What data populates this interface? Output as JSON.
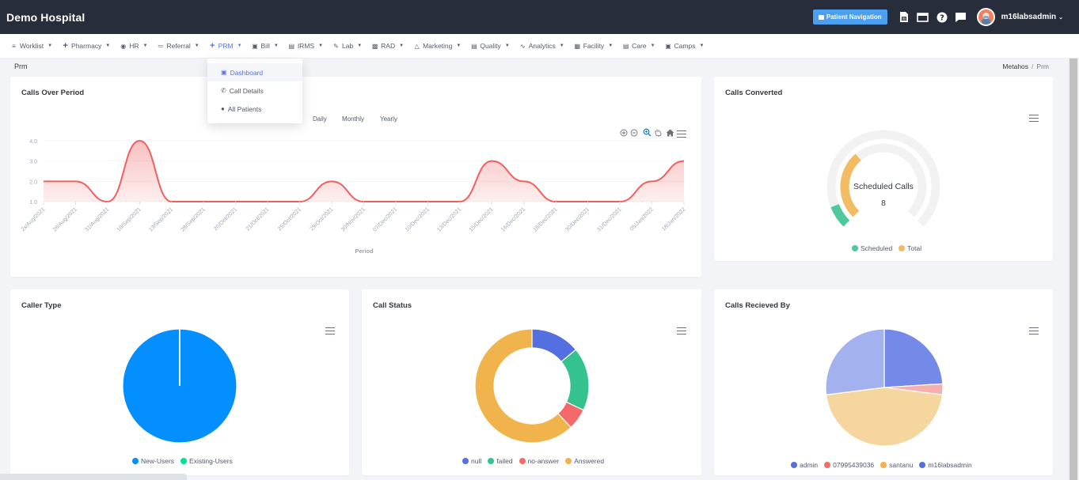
{
  "app": {
    "title": "Demo Hospital"
  },
  "topbar": {
    "patient_nav_label": "Patient Navigation",
    "icons": [
      "word-doc-icon",
      "window-icon",
      "help-icon",
      "chat-icon"
    ],
    "username": "m16labsadmin"
  },
  "menu": {
    "items": [
      {
        "label": "Worklist",
        "icon": "list-icon"
      },
      {
        "label": "Pharmacy",
        "icon": "plus-icon"
      },
      {
        "label": "HR",
        "icon": "user-circle-icon"
      },
      {
        "label": "Referral",
        "icon": "referral-icon"
      },
      {
        "label": "PRM",
        "icon": "plus-icon",
        "active": true
      },
      {
        "label": "Bill",
        "icon": "bill-icon"
      },
      {
        "label": "IRMS",
        "icon": "id-card-icon"
      },
      {
        "label": "Lab",
        "icon": "flask-icon"
      },
      {
        "label": "RAD",
        "icon": "film-icon"
      },
      {
        "label": "Marketing",
        "icon": "bag-icon"
      },
      {
        "label": "Quality",
        "icon": "quality-icon"
      },
      {
        "label": "Analytics",
        "icon": "pulse-icon"
      },
      {
        "label": "Facility",
        "icon": "building-icon"
      },
      {
        "label": "Care",
        "icon": "care-icon"
      },
      {
        "label": "Camps",
        "icon": "camp-icon"
      }
    ],
    "dropdown": [
      {
        "label": "Dashboard",
        "icon": "dashboard-icon",
        "active": true
      },
      {
        "label": "Call Details",
        "icon": "phone-icon"
      },
      {
        "label": "All Patients",
        "icon": "user-icon"
      }
    ]
  },
  "page": {
    "title": "Prm",
    "breadcrumb": [
      "Metahos",
      "Prm"
    ]
  },
  "colors": {
    "accent": "#5b73e8",
    "topbar": "#282d3c",
    "line": "#f06060"
  },
  "calls_over_period": {
    "title": "Calls Over Period",
    "range_buttons": [
      "Daily",
      "Monthly",
      "Yearly"
    ]
  },
  "calls_converted": {
    "center_label": "Scheduled Calls",
    "center_value": "8"
  },
  "chart_data": [
    {
      "type": "area",
      "title": "Calls Over Period",
      "xlabel": "Period",
      "ylabel": "",
      "ylim": [
        1,
        4
      ],
      "yticks": [
        "1.0",
        "2.0",
        "3.0",
        "4.0"
      ],
      "grid": true,
      "color": "#f06060",
      "categories": [
        "2x/Aug/2021",
        "28/Aug/2021",
        "31/Aug/2021",
        "10/Sep/2021",
        "13/Sep/2021",
        "28/Sep/2021",
        "20/Oct/2021",
        "21/Oct/2021",
        "25/Oct/2021",
        "29/Oct/2021",
        "30/Nov/2021",
        "07/Dec/2021",
        "10/Dec/2021",
        "13/Dec/2021",
        "15/Dec/2021",
        "16/Dec/2021",
        "18/Dec/2021",
        "30/Dec/2021",
        "31/Dec/2021",
        "05/Jan/2022",
        "18/Jan/2022"
      ],
      "values": [
        2,
        2,
        1,
        4,
        1,
        1,
        1,
        1,
        1,
        2,
        1,
        1,
        1,
        1,
        3,
        2,
        1,
        1,
        1,
        2,
        3
      ]
    },
    {
      "type": "radialBar",
      "title": "Calls Converted",
      "center_label": "Scheduled Calls",
      "center_value": 8,
      "series": [
        {
          "name": "Scheduled",
          "value": 8,
          "color": "#4dc99c"
        },
        {
          "name": "Total",
          "value": 34,
          "color": "#f1bc63"
        }
      ],
      "legend": "bottom"
    },
    {
      "type": "pie",
      "title": "Caller Type",
      "series": [
        {
          "name": "New-Users",
          "value": 100,
          "color": "#038fff"
        },
        {
          "name": "Existing-Users",
          "value": 0,
          "color": "#00e396"
        }
      ],
      "legend": "bottom"
    },
    {
      "type": "donut",
      "title": "Call Status",
      "series": [
        {
          "name": "null",
          "value": 14,
          "color": "#5470e0"
        },
        {
          "name": "failed",
          "value": 18,
          "color": "#34c38f"
        },
        {
          "name": "no-answer",
          "value": 6,
          "color": "#f46a6a"
        },
        {
          "name": "Answered",
          "value": 62,
          "color": "#f1b44c"
        }
      ],
      "legend": "bottom"
    },
    {
      "type": "pie",
      "title": "Calls Recieved By",
      "series": [
        {
          "name": "admin",
          "value": 24,
          "color": "#7489e8"
        },
        {
          "name": "07995439036",
          "value": 3,
          "color": "#f7aeae"
        },
        {
          "name": "santanu",
          "value": 46,
          "color": "#f6d69f"
        },
        {
          "name": "m16labsadmin",
          "value": 27,
          "color": "#a4b1ef"
        }
      ],
      "legend_colors": [
        "#5470e0",
        "#f46a6a",
        "#f1b44c",
        "#5470e0"
      ],
      "legend": "bottom"
    }
  ]
}
